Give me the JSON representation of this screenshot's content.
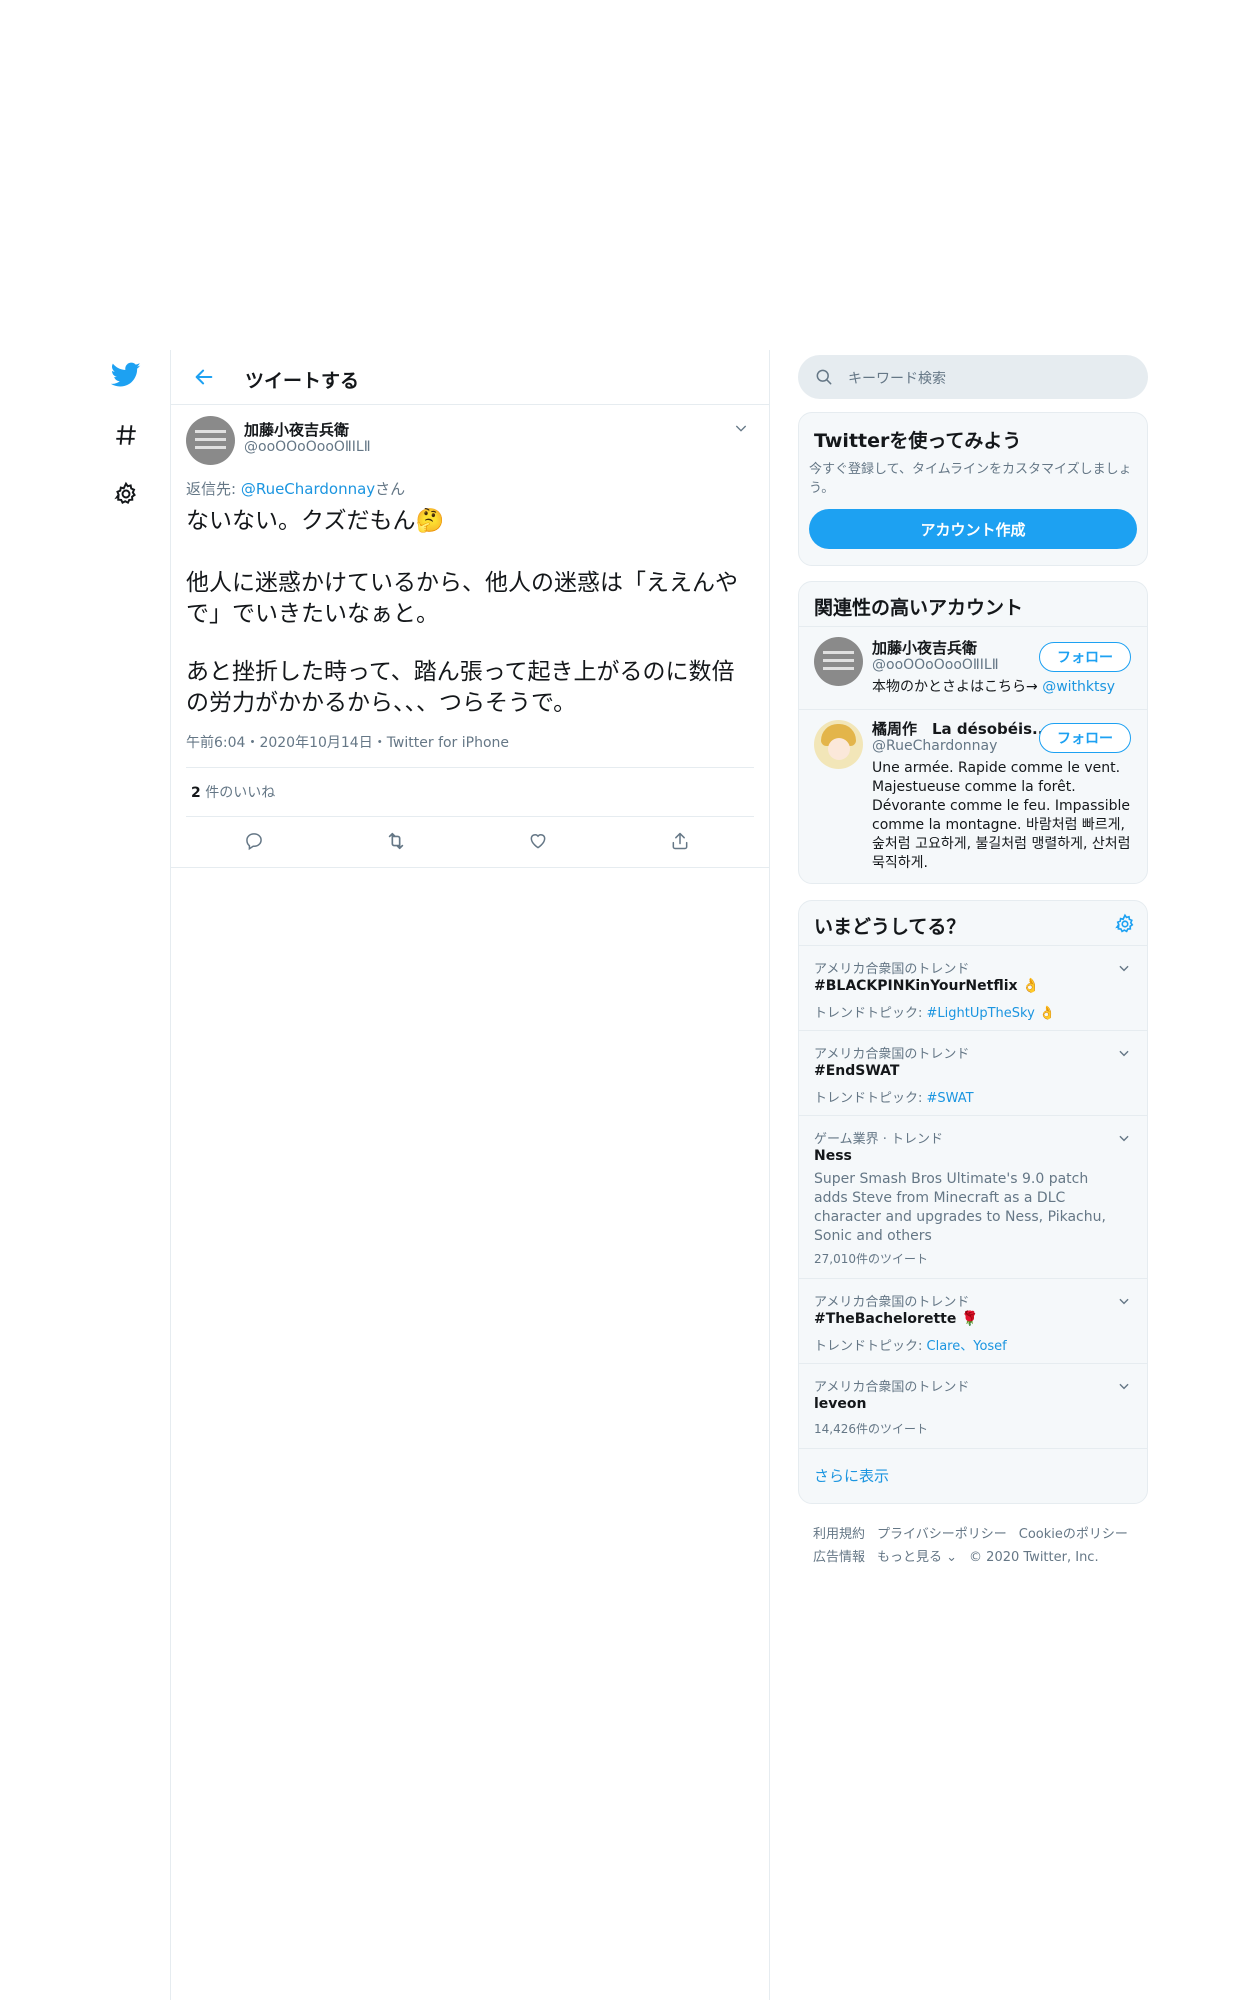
{
  "header": {
    "title": "ツイートする"
  },
  "tweet": {
    "author_name": "加藤小夜吉兵衛",
    "author_handle": "@ooOOoOooOⅡⅠⅬⅡ",
    "reply_prefix": "返信先: ",
    "reply_mention": "@RueChardonnay",
    "reply_suffix": "さん",
    "line1": "ないない。クズだもん🤔",
    "para2": "他人に迷惑かけているから、他人の迷惑は「ええんやで」でいきたいなぁと。",
    "para3": "あと挫折した時って、踏ん張って起き上がるのに数倍の労力がかかるから、、、つらそうで。",
    "meta": "午前6:04・2020年10月14日・Twitter for iPhone",
    "likes_count": "2",
    "likes_label": " 件のいいね"
  },
  "search": {
    "placeholder": "キーワード検索"
  },
  "signup": {
    "title": "Twitterを使ってみよう",
    "description": "今すぐ登録して、タイムラインをカスタマイズしましょう。",
    "button": "アカウント作成"
  },
  "related": {
    "title": "関連性の高いアカウント",
    "accounts": [
      {
        "name": "加藤小夜吉兵衛",
        "handle": "@ooOOoOooOⅡⅠⅬⅡ",
        "bio_text": "本物のかとさよはこちら→ ",
        "bio_mention": "@withktsy",
        "follow": "フォロー"
      },
      {
        "name": "橘周作　La désobéis...",
        "handle": "@RueChardonnay",
        "bio_text": "Une armée. Rapide comme le vent. Majestueuse comme la forêt. Dévorante comme le feu. Impassible comme la montagne. 바람처럼 빠르게, 숲처럼 고요하게, 불길처럼 맹렬하게, 산처럼 묵직하게.",
        "follow": "フォロー"
      }
    ]
  },
  "trends": {
    "title": "いまどうしてる？",
    "items": [
      {
        "context": "アメリカ合衆国のトレンド",
        "name": "#BLACKPINKinYourNetflix 👌",
        "sub_label": "トレンドトピック: ",
        "sub_tag": "#LightUpTheSky 👌"
      },
      {
        "context": "アメリカ合衆国のトレンド",
        "name": "#EndSWAT",
        "sub_label": "トレンドトピック: ",
        "sub_tag": "#SWAT"
      },
      {
        "context": "ゲーム業界 · トレンド",
        "name": "Ness",
        "description": "Super Smash Bros Ultimate's 9.0 patch adds Steve from Minecraft as a DLC character and upgrades to Ness, Pikachu, Sonic and others",
        "count": "27,010件のツイート"
      },
      {
        "context": "アメリカ合衆国のトレンド",
        "name": "#TheBachelorette 🌹",
        "sub_label": "トレンドトピック: ",
        "sub_tag": "Clare、Yosef"
      },
      {
        "context": "アメリカ合衆国のトレンド",
        "name": "leveon",
        "count": "14,426件のツイート"
      }
    ],
    "show_more": "さらに表示"
  },
  "footer": {
    "row1": [
      "利用規約",
      "プライバシーポリシー",
      "Cookieのポリシー"
    ],
    "row2": [
      "広告情報",
      "もっと見る ⌄",
      "© 2020 Twitter, Inc."
    ]
  },
  "colors": {
    "accent": "#1da1f2",
    "link": "#1b95e0",
    "border": "#e6ecf0",
    "muted": "#657786"
  },
  "icons": [
    "twitter-logo-icon",
    "hashtag-icon",
    "gear-icon",
    "back-arrow-icon",
    "chevron-down-icon",
    "reply-icon",
    "retweet-icon",
    "like-icon",
    "share-icon",
    "search-icon"
  ]
}
